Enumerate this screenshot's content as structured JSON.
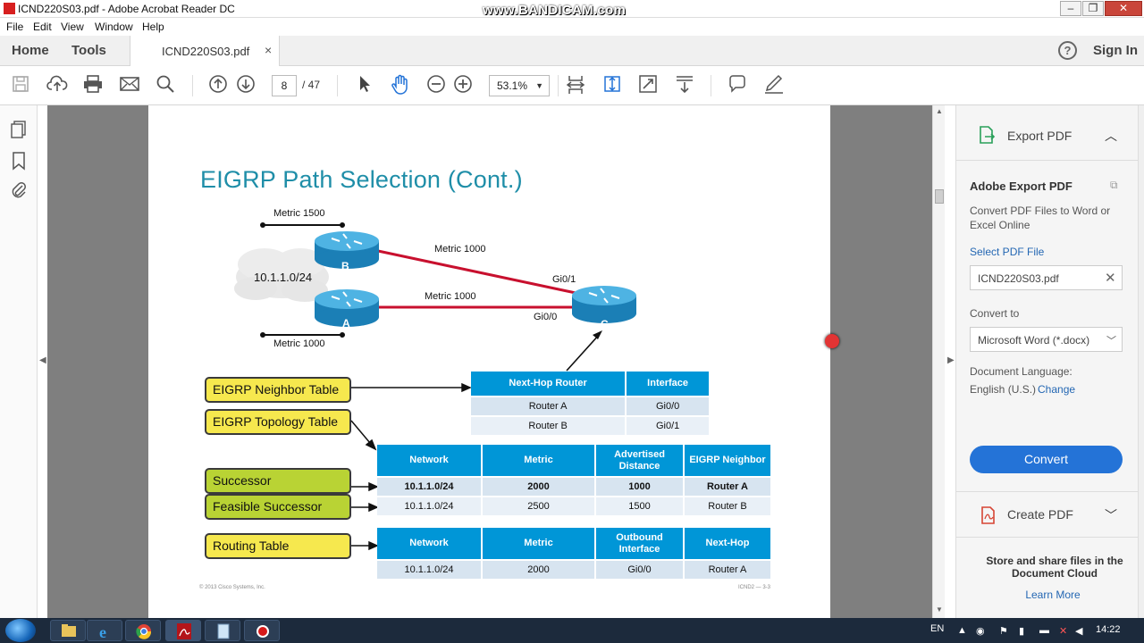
{
  "window": {
    "title": "ICND220S03.pdf - Adobe Acrobat Reader DC",
    "watermark": "www.BANDICAM.com",
    "min": "–",
    "max": "❐",
    "close": "✕"
  },
  "menu": [
    "File",
    "Edit",
    "View",
    "Window",
    "Help"
  ],
  "tabs": {
    "home": "Home",
    "tools": "Tools",
    "doc": "ICND220S03.pdf",
    "close": "×"
  },
  "header": {
    "help": "?",
    "sign_in": "Sign In"
  },
  "toolbar": {
    "page_current": "8",
    "page_total": "/ 47",
    "zoom": "53.1%"
  },
  "slide": {
    "title": "EIGRP Path Selection (Cont.)",
    "metric_b_left": "Metric 1500",
    "metric_a_left": "Metric 1000",
    "metric_b_c": "Metric 1000",
    "metric_a_c": "Metric 1000",
    "network_cloud": "10.1.1.0/24",
    "router_b": "B",
    "router_a": "A",
    "router_c": "C",
    "if_c_top": "Gi0/1",
    "if_c_bottom": "Gi0/0",
    "labels": {
      "neighbor": "EIGRP Neighbor Table",
      "topology": "EIGRP Topology Table",
      "successor": "Successor",
      "feasible": "Feasible Successor",
      "routing": "Routing Table"
    },
    "neighbor_table": {
      "headers": [
        "Next-Hop Router",
        "Interface"
      ],
      "rows": [
        [
          "Router A",
          "Gi0/0"
        ],
        [
          "Router B",
          "Gi0/1"
        ]
      ]
    },
    "topology_table": {
      "headers": [
        "Network",
        "Metric",
        "Advertised Distance",
        "EIGRP Neighbor"
      ],
      "rows": [
        [
          "10.1.1.0/24",
          "2000",
          "1000",
          "Router A"
        ],
        [
          "10.1.1.0/24",
          "2500",
          "1500",
          "Router B"
        ]
      ]
    },
    "routing_table": {
      "headers": [
        "Network",
        "Metric",
        "Outbound Interface",
        "Next-Hop"
      ],
      "rows": [
        [
          "10.1.1.0/24",
          "2000",
          "Gi0/0",
          "Router A"
        ]
      ]
    },
    "footer_left": "© 2013 Cisco Systems, Inc.",
    "footer_right": "ICND2 — 3-3"
  },
  "right_panel": {
    "export_title": "Export PDF",
    "heading": "Adobe Export PDF",
    "description": "Convert PDF Files to Word or Excel Online",
    "select_file": "Select PDF File",
    "file_name": "ICND220S03.pdf",
    "convert_to_label": "Convert to",
    "convert_to_value": "Microsoft Word (*.docx)",
    "language_label": "Document Language:",
    "language_value": "English (U.S.)",
    "change": "Change",
    "convert_button": "Convert",
    "create_title": "Create PDF",
    "cloud_text": "Store and share files in the Document Cloud",
    "learn_more": "Learn More"
  },
  "taskbar": {
    "lang": "EN",
    "time": "14:22"
  },
  "colors": {
    "accent_blue": "#2473d7",
    "table_header": "#0096d7",
    "label_yellow": "#f6e84e",
    "label_green": "#b9d334",
    "link_red": "#c8102e",
    "title_teal": "#1f8ea8"
  }
}
